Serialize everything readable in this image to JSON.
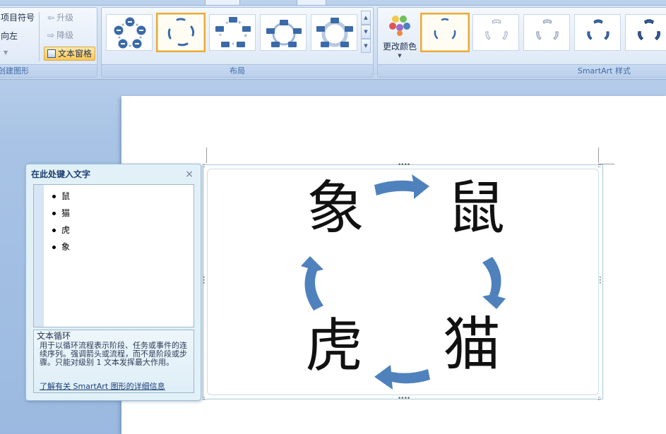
{
  "ribbon": {
    "create_group": {
      "bullet_label": "项目符号",
      "rtl_label": "向左",
      "promote_label": "升级",
      "demote_label": "降级",
      "text_pane_label": "文本窗格",
      "group_label": "创建图形"
    },
    "layout_group": {
      "group_label": "布局",
      "layouts": [
        "基本循环",
        "文本循环",
        "块循环",
        "不定向循环",
        "连续循环"
      ],
      "selected_index": 1
    },
    "styles_group": {
      "change_color_label": "更改颜色",
      "group_label": "SmartArt 样式",
      "selected_index": 0
    }
  },
  "text_pane": {
    "title": "在此处键入文字",
    "close_glyph": "×",
    "items": [
      "鼠",
      "猫",
      "虎",
      "象"
    ],
    "desc_title": "文本循环",
    "desc_body": "用于以循环流程表示阶段、任务或事件的连续序列。强调箭头或流程，而不是阶段或步骤。只能对级别 1 文本发挥最大作用。",
    "link_text": "了解有关 SmartArt 图形的详细信息"
  },
  "diagram": {
    "nodes": [
      "鼠",
      "猫",
      "虎",
      "象"
    ],
    "arrow_color": "#4f81bd"
  },
  "colors": {
    "accent": "#4f81bd",
    "ribbon_label": "#3e6aa5",
    "selection": "#e9a93b"
  }
}
